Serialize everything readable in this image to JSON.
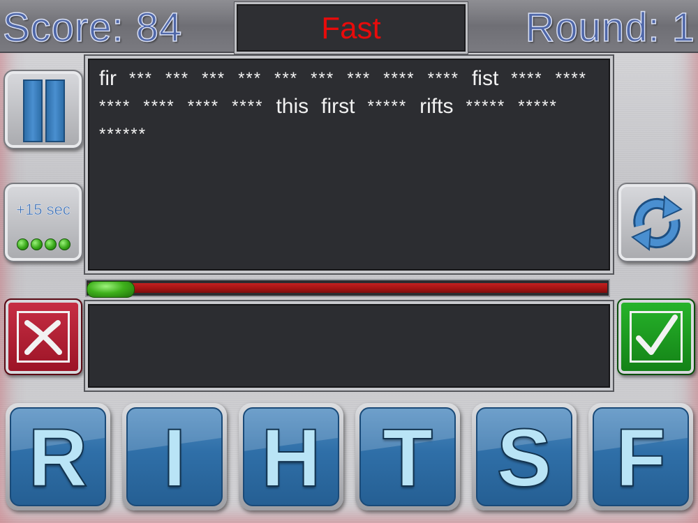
{
  "header": {
    "score_label": "Score: 84",
    "mode": "Fast",
    "round_label": "Round: 1"
  },
  "words": [
    {
      "text": "fir",
      "found": true
    },
    {
      "text": "***",
      "found": false
    },
    {
      "text": "***",
      "found": false
    },
    {
      "text": "***",
      "found": false
    },
    {
      "text": "***",
      "found": false
    },
    {
      "text": "***",
      "found": false
    },
    {
      "text": "***",
      "found": false
    },
    {
      "text": "***",
      "found": false
    },
    {
      "text": "****",
      "found": false
    },
    {
      "text": "****",
      "found": false
    },
    {
      "text": "fist",
      "found": true
    },
    {
      "text": "****",
      "found": false
    },
    {
      "text": "****",
      "found": false
    },
    {
      "text": "****",
      "found": false
    },
    {
      "text": "****",
      "found": false
    },
    {
      "text": "****",
      "found": false
    },
    {
      "text": "****",
      "found": false
    },
    {
      "text": "this",
      "found": true
    },
    {
      "text": "first",
      "found": true
    },
    {
      "text": "*****",
      "found": false
    },
    {
      "text": "rifts",
      "found": true
    },
    {
      "text": "*****",
      "found": false
    },
    {
      "text": "*****",
      "found": false
    },
    {
      "text": "******",
      "found": false
    }
  ],
  "timer": {
    "remaining_fraction": 0.09
  },
  "controls": {
    "bonus_label": "+15 sec",
    "bonus_charges": 4
  },
  "input": {
    "value": ""
  },
  "tiles": [
    "R",
    "I",
    "H",
    "T",
    "S",
    "F"
  ],
  "colors": {
    "mode_text": "#e80b0b",
    "score_text": "#4f67a8",
    "timer_red": "#a01313",
    "timer_green": "#3fb11c",
    "tile_blue": "#2f6fa8",
    "submit_green": "#138016",
    "cancel_red": "#9a1325"
  },
  "icons": {
    "pause": "pause-icon",
    "shuffle": "shuffle-icon",
    "cancel": "close-icon",
    "submit": "checkmark-icon"
  }
}
